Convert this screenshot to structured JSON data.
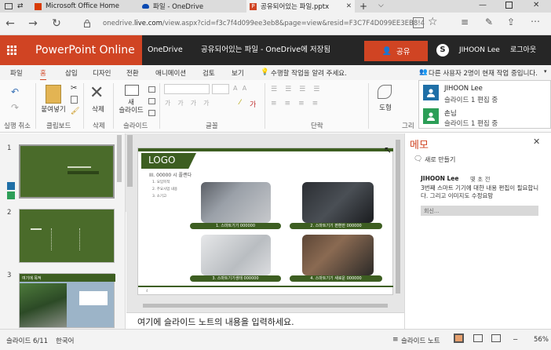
{
  "browser": {
    "tabs": [
      {
        "title": "Microsoft Office Home",
        "icon": "office-icon",
        "color": "#d83b01"
      },
      {
        "title": "파일 - OneDrive",
        "icon": "onedrive-icon",
        "color": "#094ab2"
      },
      {
        "title": "공유되어있는 파일.pptx",
        "icon": "powerpoint-icon",
        "color": "#d04423"
      }
    ],
    "url_prefix": "onedrive.",
    "url_domain": "live.com",
    "url_rest": "/view.aspx?cid=f3c7f4d099ee3eb8&page=view&resid=F3C7F4D099EE3EB8!420"
  },
  "office": {
    "app_name": "PowerPoint Online",
    "onedrive": "OneDrive",
    "doc_title": "공유되어있는 파일  -  OneDrive에 저장됨",
    "share": "공유",
    "user": "JIHOON Lee",
    "signout": "로그아웃",
    "brand_color": "#d04423"
  },
  "ribbon_tabs": [
    "파일",
    "홈",
    "삽입",
    "디자인",
    "전환",
    "애니메이션",
    "검토",
    "보기"
  ],
  "tell_me": "수행할 작업을 알려 주세요.",
  "collab_notice": "다른 사용자 2명이 현재 작업 중입니다.",
  "ribbon": {
    "undo_group": "실행 취소",
    "paste": "붙여넣기",
    "clipboard_group": "클립보드",
    "delete": "삭제",
    "delete_group": "삭제",
    "new_slide": "새\n슬라이드",
    "slides_group": "슬라이드",
    "font_group": "글꼴",
    "paragraph_group": "단락",
    "shapes": "도형",
    "drawing_group": "그리"
  },
  "presence": [
    {
      "name": "JIHOON Lee",
      "status": "슬라이드 1 편집 중",
      "color": "#1f6fa7"
    },
    {
      "name": "손님",
      "status": "슬라이드 1 편집 중",
      "color": "#2c9e57"
    }
  ],
  "thumbnails": [
    {
      "num": "1",
      "bg": "#4a6b2a"
    },
    {
      "num": "2",
      "bg": "#4a6b2a"
    },
    {
      "num": "3",
      "title": "여기에 목적"
    }
  ],
  "slide": {
    "logo": "LOGO",
    "heading": "III. 00000 시 플랜다",
    "bullets": [
      "1. 요입목적",
      "2. 주요사업 내용",
      "3. 소기고"
    ],
    "captions": [
      "1. 스마트기기 000000",
      "2. 스마트기기 편환한 000000",
      "3. 스마트기기생태 000000",
      "4. 스마트기기 새로운 000000"
    ],
    "page": "4",
    "accent": "#3d5e21"
  },
  "notes_placeholder": "여기에 슬라이드 노트의 내용을 입력하세요.",
  "memo": {
    "title": "메모",
    "new": "새로 만들기",
    "author": "JIHOON Lee",
    "time": "몇 초 전",
    "text": "3번째 스마트 기기에 대한 내용 편집이 필요합니다. 그리고 이미지도 수정요망",
    "reply_placeholder": "회신..."
  },
  "status": {
    "slide": "슬라이드 6/11",
    "lang": "한국어",
    "notes_btn": "슬라이드 노트",
    "zoom": "56%"
  }
}
